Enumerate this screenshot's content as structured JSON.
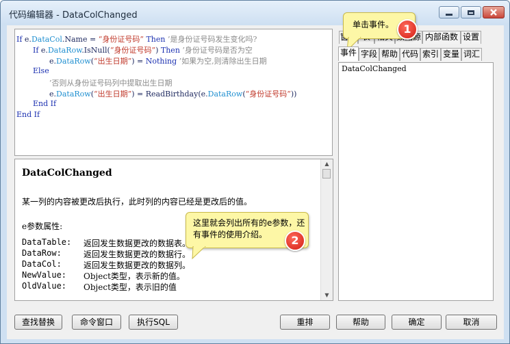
{
  "window": {
    "title": "代码编辑器 - DataColChanged"
  },
  "code_lines": [
    [
      [
        "kw",
        "If "
      ],
      [
        "blk",
        "e."
      ],
      [
        "id",
        "DataCol"
      ],
      [
        "blk",
        ".Name = "
      ],
      [
        "str",
        "“身份证号码”"
      ],
      [
        "kw",
        " Then "
      ],
      [
        "cmt",
        "’是身份证号码发生变化吗?"
      ]
    ],
    [
      [
        "kw",
        "If "
      ],
      [
        "blk",
        "e."
      ],
      [
        "id",
        "DataRow"
      ],
      [
        "blk",
        ".IsNull("
      ],
      [
        "str",
        "“身份证号码”"
      ],
      [
        "blk",
        ") "
      ],
      [
        "kw",
        "Then "
      ],
      [
        "cmt",
        "’身份证号码是否为空"
      ]
    ],
    [
      [
        "blk",
        "e."
      ],
      [
        "id",
        "DataRow"
      ],
      [
        "blk",
        "("
      ],
      [
        "str",
        "“出生日期”"
      ],
      [
        "blk",
        ") = "
      ],
      [
        "kw",
        "Nothing "
      ],
      [
        "cmt",
        "’如果为空,则清除出生日期"
      ]
    ],
    [
      [
        "kw",
        "Else"
      ]
    ],
    [
      [
        "cmt",
        "’否则从身份证号码列中提取出生日期"
      ]
    ],
    [
      [
        "blk",
        "e."
      ],
      [
        "id",
        "DataRow"
      ],
      [
        "blk",
        "("
      ],
      [
        "str",
        "“出生日期”"
      ],
      [
        "blk",
        ") = ReadBirthday(e."
      ],
      [
        "id",
        "DataRow"
      ],
      [
        "blk",
        "("
      ],
      [
        "str",
        "“身份证号码”"
      ],
      [
        "blk",
        "))"
      ]
    ],
    [
      [
        "kw",
        "End If"
      ]
    ],
    [
      [
        "kw",
        "End If"
      ]
    ]
  ],
  "help": {
    "title": "DataColChanged",
    "description": "某一列的内容被更改后执行，此时列的内容已经是更改后的值。",
    "params_heading": "e参数属性:",
    "params": [
      {
        "name": "DataTable:",
        "desc": "返回发生数据更改的数据表。"
      },
      {
        "name": "DataRow:",
        "desc": "返回发生数据更改的数据行。"
      },
      {
        "name": "DataCol:",
        "desc": "返回发生数据更改的数据列。"
      },
      {
        "name": "NewValue:",
        "desc": "Object类型，表示新的值。"
      },
      {
        "name": "OldValue:",
        "desc": "Object类型，表示旧的值"
      }
    ]
  },
  "tabs_top": [
    "窗口",
    "表",
    "相关",
    "数据源",
    "内部函数",
    "设置"
  ],
  "tabs_bottom": [
    "事件",
    "字段",
    "帮助",
    "代码",
    "索引",
    "变量",
    "词汇"
  ],
  "event_list": [
    "DataColChanged"
  ],
  "buttons": {
    "find_replace": "查找替换",
    "command_window": "命令窗口",
    "execute_sql": "执行SQL",
    "rearrange": "重排",
    "help": "帮助",
    "ok": "确定",
    "cancel": "取消"
  },
  "callouts": {
    "one": {
      "text": "单击事件。",
      "badge": "1"
    },
    "two": {
      "text": "这里就会列出所有的e参数，还有事件的使用介绍。",
      "badge": "2"
    }
  },
  "colors": {
    "keyword": "#1a2fb0",
    "identifier": "#1f8fd0",
    "string": "#c0392b",
    "comment": "#8a8a8a",
    "callout": "#fdf7a6",
    "badge": "#d21e12"
  }
}
